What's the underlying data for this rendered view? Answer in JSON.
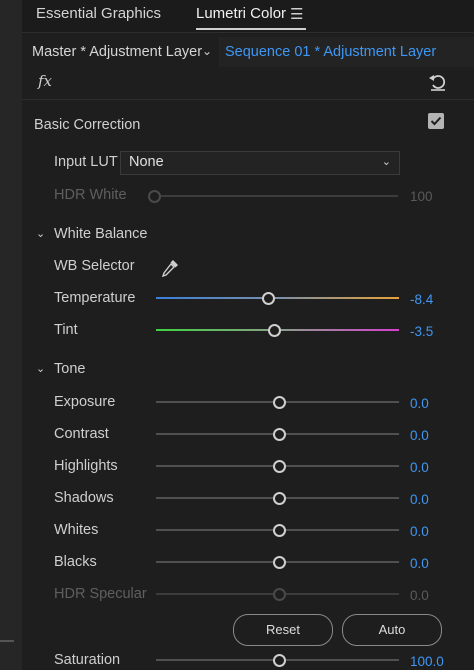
{
  "tabs": {
    "essential": "Essential Graphics",
    "lumetri": "Lumetri Color",
    "menu_icon": "hamburger-menu-icon"
  },
  "clip": {
    "master": "Master * Adjustment Layer",
    "sequence": "Sequence 01 * Adjustment Layer"
  },
  "fx": {
    "label": "fx",
    "reset_icon": "reset-arrow-icon"
  },
  "basic": {
    "title": "Basic Correction",
    "enabled": true,
    "input_lut": {
      "label": "Input LUT",
      "value": "None"
    },
    "hdr_white": {
      "label": "HDR White",
      "value": "100"
    }
  },
  "white_balance": {
    "title": "White Balance",
    "wb_selector": "WB Selector",
    "temperature": {
      "label": "Temperature",
      "value": "-8.4"
    },
    "tint": {
      "label": "Tint",
      "value": "-3.5"
    }
  },
  "tone": {
    "title": "Tone",
    "exposure": {
      "label": "Exposure",
      "value": "0.0"
    },
    "contrast": {
      "label": "Contrast",
      "value": "0.0"
    },
    "highlights": {
      "label": "Highlights",
      "value": "0.0"
    },
    "shadows": {
      "label": "Shadows",
      "value": "0.0"
    },
    "whites": {
      "label": "Whites",
      "value": "0.0"
    },
    "blacks": {
      "label": "Blacks",
      "value": "0.0"
    },
    "hdr_specular": {
      "label": "HDR Specular",
      "value": "0.0"
    },
    "reset_label": "Reset",
    "auto_label": "Auto",
    "saturation": {
      "label": "Saturation",
      "value": "100.0"
    }
  },
  "colors": {
    "accent": "#3e97f5",
    "temperature_start": "#3b7fd9",
    "temperature_end": "#e7a23a",
    "tint_start": "#3fd23f",
    "tint_end": "#d63fd0"
  }
}
